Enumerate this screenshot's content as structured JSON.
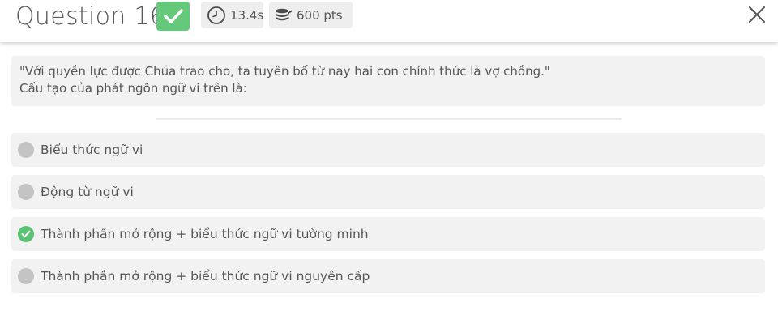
{
  "header": {
    "title": "Question 16",
    "result_icon": "check-icon",
    "time": "13.4s",
    "time_icon": "clock-icon",
    "points": "600 pts",
    "points_icon": "coins-icon",
    "close_icon": "close-icon"
  },
  "question": {
    "line1": "\"Với quyền lực được Chúa trao cho, ta tuyên bố từ nay hai con chính thức là vợ chồng.\"",
    "line2": "Cấu tạo của phát ngôn ngữ vi trên là:"
  },
  "options": [
    {
      "label": "Biểu thức ngữ vi",
      "state": "unselected"
    },
    {
      "label": "Động từ ngữ vi",
      "state": "unselected"
    },
    {
      "label": "Thành phần mở rộng + biểu thức ngữ vi tường minh",
      "state": "correct"
    },
    {
      "label": "Thành phần mở rộng + biểu thức ngữ vi nguyên cấp",
      "state": "unselected"
    }
  ],
  "colors": {
    "correct": "#66c87a",
    "option_bg": "#f2f2f2",
    "radio_unselected": "#c4c4c4",
    "text": "#555555"
  }
}
